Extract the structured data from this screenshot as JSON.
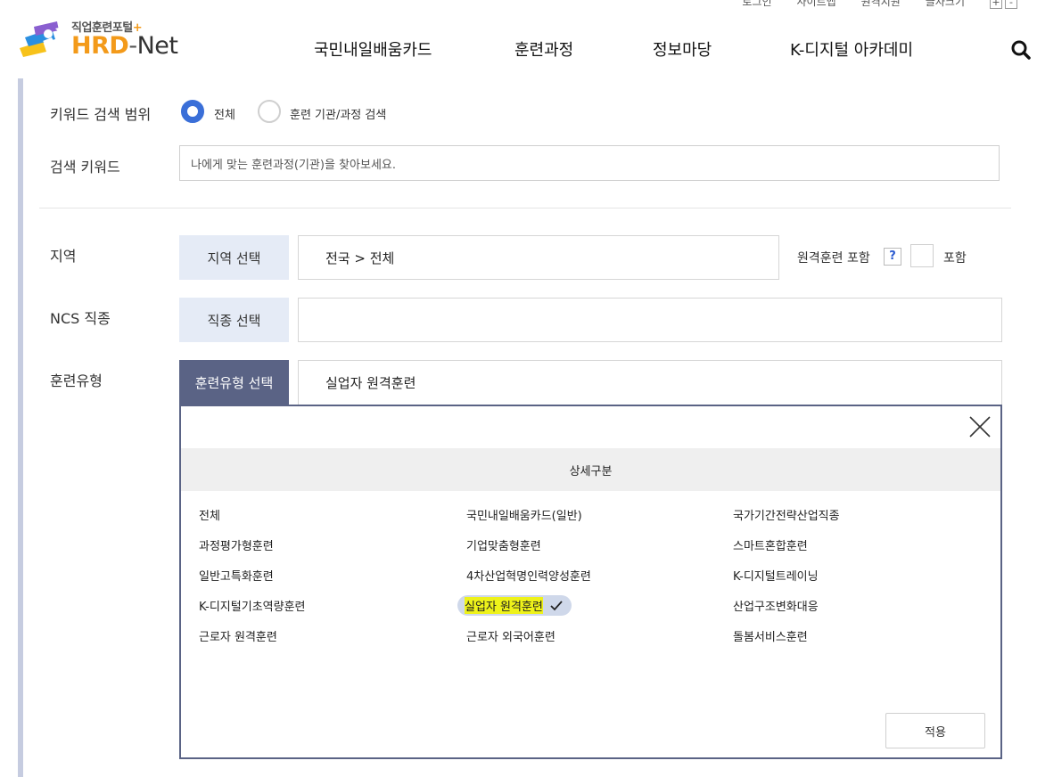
{
  "header": {
    "util_links": [
      "로그인",
      "사이트맵",
      "원격지원",
      "글자크기"
    ],
    "font_plus": "+",
    "font_minus": "-",
    "logo_sub": "직업훈련포털",
    "logo_sub_plus": "+",
    "logo_hrd": "HRD",
    "logo_dash": "-",
    "logo_net": "Net",
    "nav": [
      "국민내일배움카드",
      "훈련과정",
      "정보마당",
      "K-디지털 아카데미"
    ],
    "search_icon": "search-icon"
  },
  "form": {
    "keyword_scope_label": "키워드 검색 범위",
    "scope_options": [
      {
        "label": "전체",
        "checked": true
      },
      {
        "label": "훈련 기관/과정 검색",
        "checked": false
      }
    ],
    "keyword_label": "검색 키워드",
    "keyword_placeholder": "나에게 맞는 훈련과정(기관)을 찾아보세요.",
    "region_label": "지역",
    "region_button": "지역 선택",
    "region_value": "전국 > 전체",
    "remote_label": "원격훈련 포함",
    "help_mark": "?",
    "remote_check_label": "포함",
    "remote_checked": false,
    "ncs_label": "NCS 직종",
    "ncs_button": "직종 선택",
    "ncs_value": "",
    "type_label": "훈련유형",
    "type_button": "훈련유형 선택",
    "type_value": "실업자 원격훈련"
  },
  "popup": {
    "close_icon": "close-icon",
    "header": "상세구분",
    "options": [
      [
        "전체",
        "국민내일배움카드(일반)",
        "국가기간전략산업직종"
      ],
      [
        "과정평가형훈련",
        "기업맞춤형훈련",
        "스마트혼합훈련"
      ],
      [
        "일반고특화훈련",
        "4차산업혁명인력양성훈련",
        "K-디지털트레이닝"
      ],
      [
        "K-디지털기초역량훈련",
        "실업자 원격훈련",
        "산업구조변화대응"
      ],
      [
        "근로자 원격훈련",
        "근로자 외국어훈련",
        "돌봄서비스훈련"
      ]
    ],
    "selected": "실업자 원격훈련",
    "apply_label": "적용"
  },
  "colors": {
    "accent_blue": "#3a6fd8",
    "active_button": "#5a6385",
    "button_bg": "#e5ebf6",
    "logo_orange": "#f39a1a",
    "highlight": "#eef21a"
  }
}
